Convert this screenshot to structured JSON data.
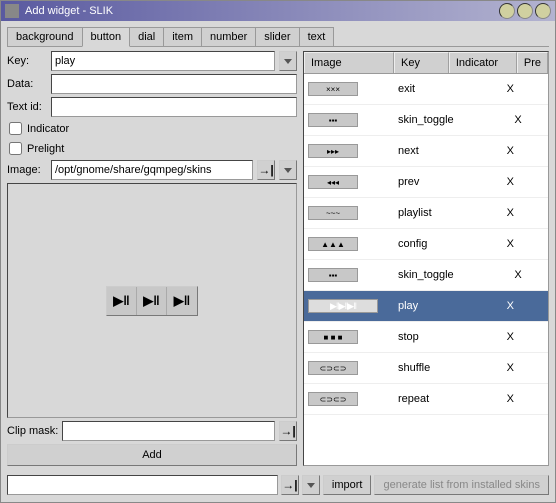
{
  "window": {
    "title": "Add widget - SLIK"
  },
  "tabs": [
    "background",
    "button",
    "dial",
    "item",
    "number",
    "slider",
    "text"
  ],
  "active_tab_index": 1,
  "form": {
    "key_label": "Key:",
    "key_value": "play",
    "data_label": "Data:",
    "data_value": "",
    "textid_label": "Text id:",
    "textid_value": "",
    "indicator_label": "Indicator",
    "indicator_checked": false,
    "prelight_label": "Prelight",
    "prelight_checked": false,
    "image_label": "Image:",
    "image_value": "/opt/gnome/share/gqmpeg/skins",
    "clipmask_label": "Clip mask:",
    "clipmask_value": "",
    "add_label": "Add"
  },
  "list": {
    "headers": {
      "image": "Image",
      "key": "Key",
      "indicator": "Indicator",
      "prelight": "Pre"
    },
    "rows": [
      {
        "key": "exit",
        "indicator": "X",
        "thumb": "×××",
        "selected": false
      },
      {
        "key": "skin_toggle",
        "indicator": "X",
        "thumb": "▪▪▪",
        "selected": false
      },
      {
        "key": "next",
        "indicator": "X",
        "thumb": "▸▸▸",
        "selected": false
      },
      {
        "key": "prev",
        "indicator": "X",
        "thumb": "◂◂◂",
        "selected": false
      },
      {
        "key": "playlist",
        "indicator": "X",
        "thumb": "~~~",
        "selected": false
      },
      {
        "key": "config",
        "indicator": "X",
        "thumb": "▲▲▲",
        "selected": false
      },
      {
        "key": "skin_toggle",
        "indicator": "X",
        "thumb": "▪▪▪",
        "selected": false
      },
      {
        "key": "play",
        "indicator": "X",
        "thumb": "▶‖▶‖▶‖",
        "selected": true,
        "wide": true
      },
      {
        "key": "stop",
        "indicator": "X",
        "thumb": "■ ■ ■",
        "selected": false
      },
      {
        "key": "shuffle",
        "indicator": "X",
        "thumb": "⊂⊃⊂⊃",
        "selected": false
      },
      {
        "key": "repeat",
        "indicator": "X",
        "thumb": "⊂⊃⊂⊃",
        "selected": false
      }
    ]
  },
  "bottom": {
    "import_label": "import",
    "generate_label": "generate list from installed skins"
  },
  "preview_cells": [
    "▶‖",
    "▶‖",
    "▶‖"
  ]
}
